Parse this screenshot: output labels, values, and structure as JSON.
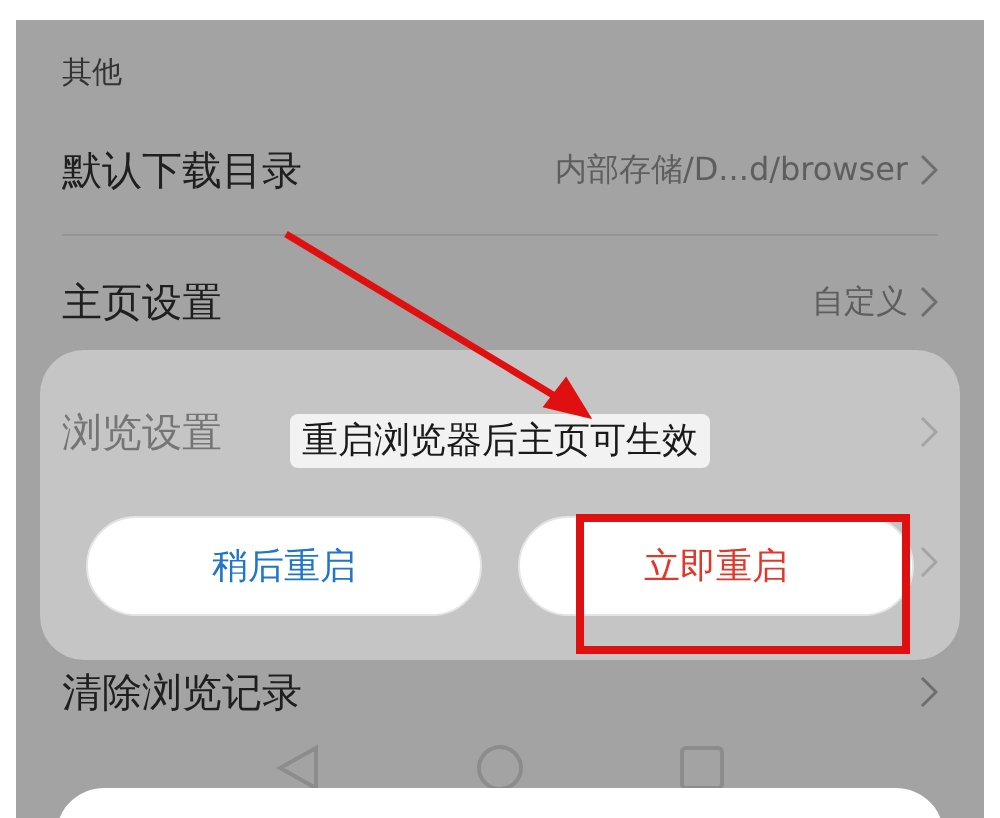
{
  "section_header": "其他",
  "settings_rows": [
    {
      "label": "默认下载目录",
      "value": "内部存储/D...d/browser"
    },
    {
      "label": "主页设置",
      "value": "自定义"
    },
    {
      "label": "浏览设置"
    },
    {},
    {
      "label": "清除浏览记录"
    }
  ],
  "dialog": {
    "message": "重启浏览器后主页可生效",
    "buttons": [
      {
        "label": "稍后重启",
        "kind": "secondary"
      },
      {
        "label": "立即重启",
        "kind": "primary"
      }
    ]
  }
}
